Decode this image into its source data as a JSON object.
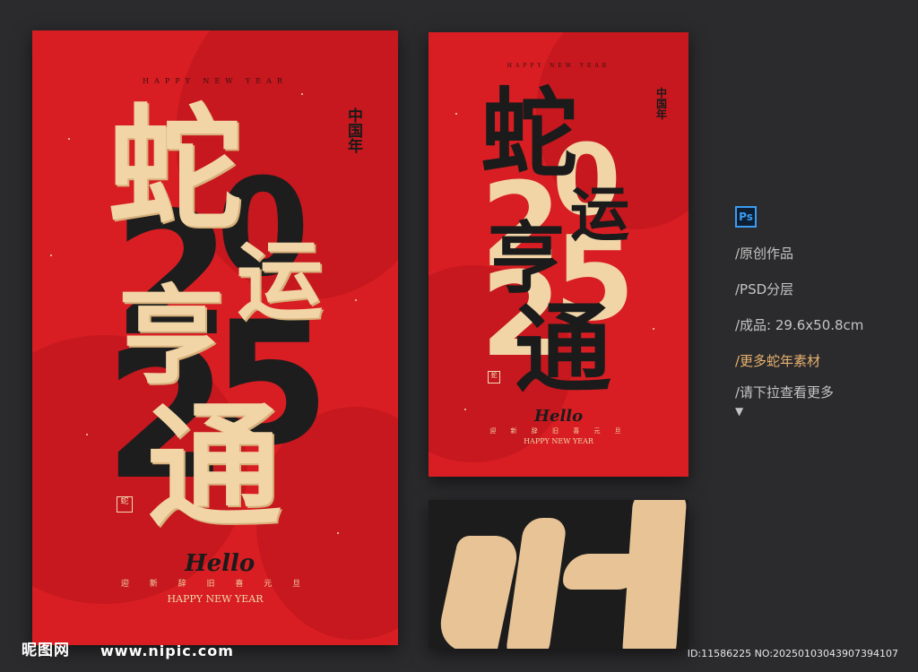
{
  "poster_main": {
    "header": "HAPPY NEW YEAR",
    "badge": "中国年",
    "year_digits": [
      "2",
      "0",
      "2",
      "5"
    ],
    "calligraphy": [
      "蛇",
      "运",
      "亨",
      "通"
    ],
    "seal": "蛇",
    "hello": "Hello",
    "footer_cn": "迎 新 辞 旧 喜 元 旦",
    "footer_en": "HAPPY NEW YEAR"
  },
  "poster_secondary": {
    "header": "HAPPY NEW YEAR",
    "badge": "中国年",
    "year_digits": [
      "2",
      "0",
      "2",
      "5"
    ],
    "calligraphy": [
      "蛇",
      "运",
      "亨",
      "通"
    ],
    "seal": "蛇",
    "hello": "Hello",
    "footer_cn": "迎 新 辞 旧 喜 元 旦",
    "footer_en": "HAPPY NEW YEAR"
  },
  "info_panel": {
    "ps_badge": "Ps",
    "items": [
      "/原创作品",
      "/PSD分层",
      "/成品: 29.6x50.8cm",
      "/更多蛇年素材",
      "/请下拉查看更多"
    ],
    "arrow": "▼"
  },
  "watermark": {
    "logo": "昵图网",
    "url": "www.nipic.com",
    "id": "ID:11586225 NO:20250103043907394107"
  },
  "colors": {
    "background": "#2b2b2d",
    "poster_red": "#d81e23",
    "cream": "#f1d5a7",
    "ink": "#1b1b1b",
    "highlight": "#e8b26f",
    "ps_blue": "#3b9cf0"
  }
}
